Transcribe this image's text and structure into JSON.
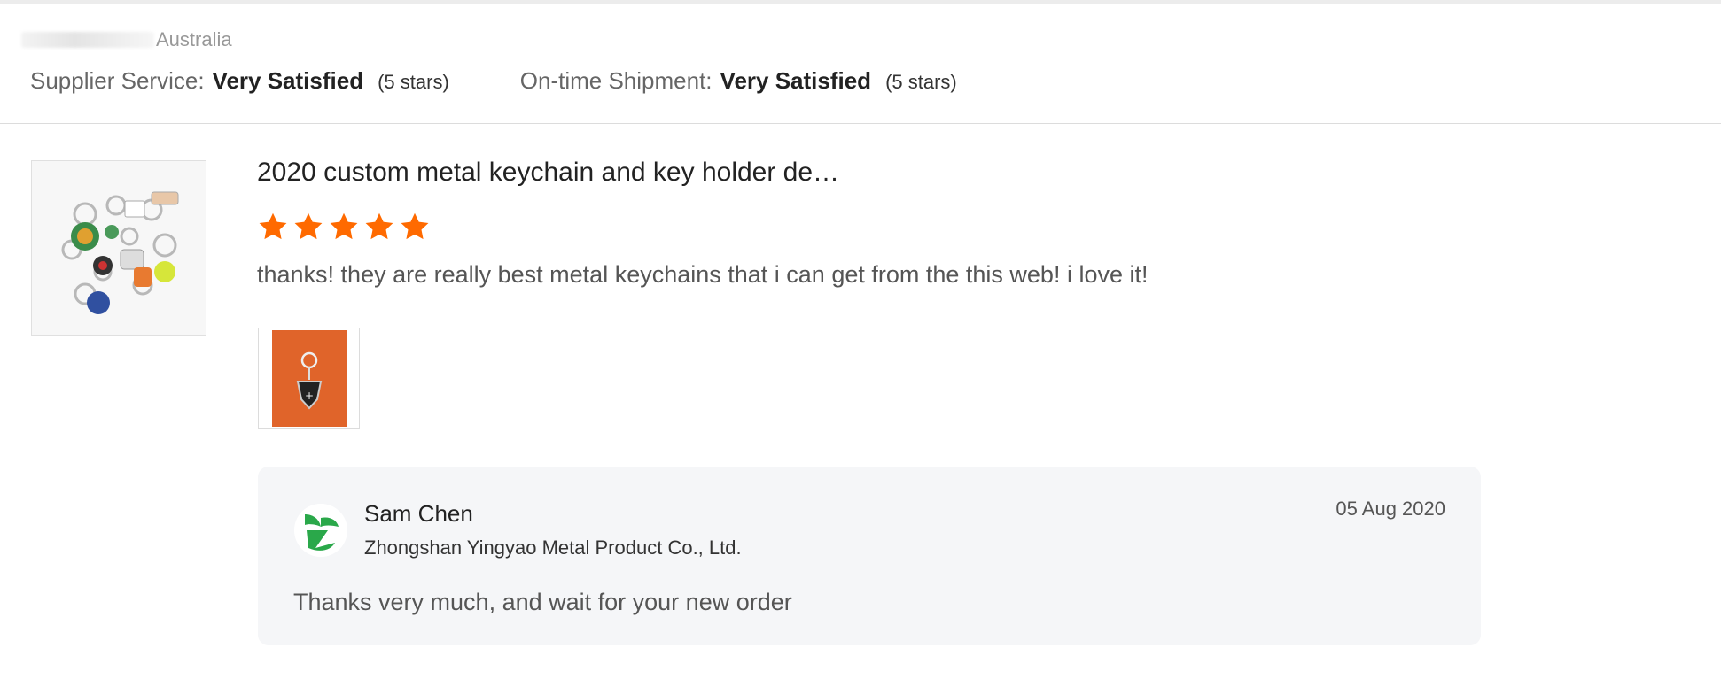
{
  "reviewer": {
    "country": "Australia"
  },
  "ratings": [
    {
      "label": "Supplier Service:",
      "value": "Very Satisfied",
      "stars_text": "(5 stars)"
    },
    {
      "label": "On-time Shipment:",
      "value": "Very Satisfied",
      "stars_text": "(5 stars)"
    }
  ],
  "product": {
    "title": "2020 custom metal keychain and key holder de…",
    "rating": 5,
    "rating_max": 5,
    "review_text": "thanks! they are really best metal keychains that i can get from the this web! i love it!"
  },
  "colors": {
    "star": "#ff6a00",
    "reply_bg": "#f5f6f8",
    "photo_bg": "#e0642a",
    "avatar_green": "#2aa84a"
  },
  "reply": {
    "name": "Sam Chen",
    "company": "Zhongshan Yingyao Metal Product Co., Ltd.",
    "date": "05 Aug 2020",
    "text": "Thanks very much, and wait for your new order"
  }
}
